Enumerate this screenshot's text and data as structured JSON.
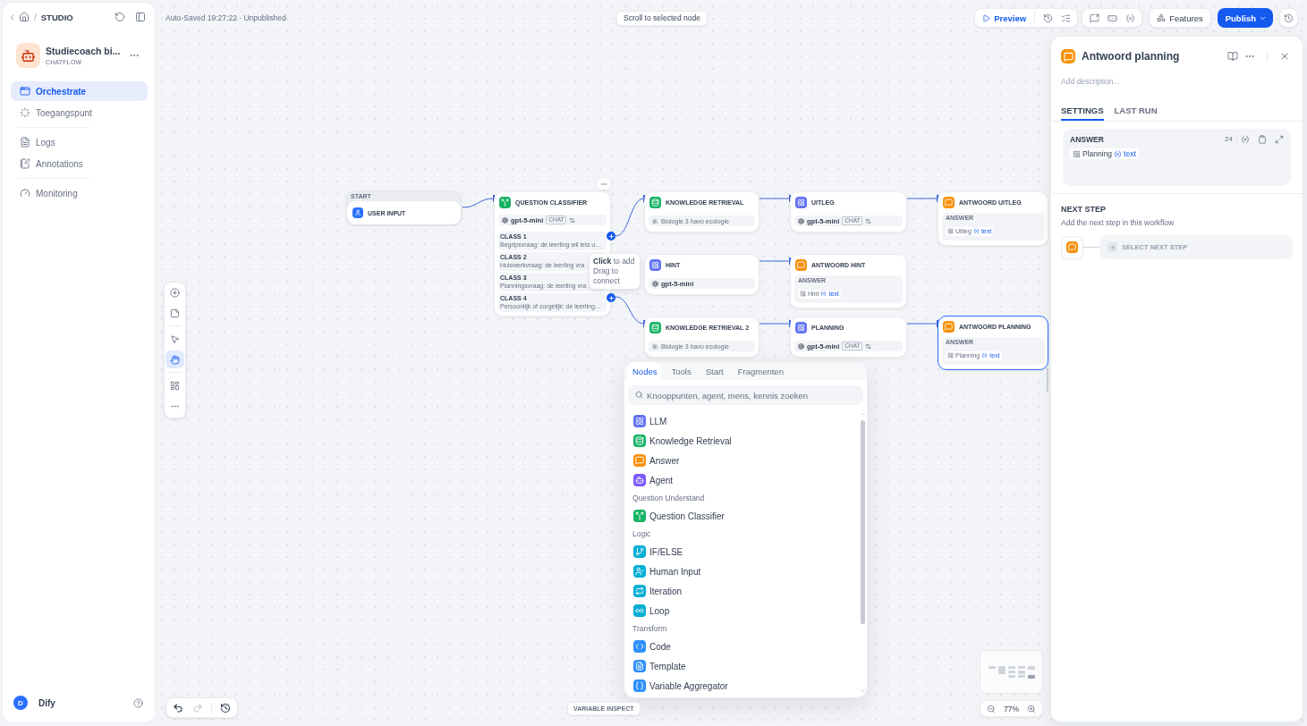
{
  "sidebar": {
    "breadcrumb": {
      "separator": "/",
      "current": "STUDIO"
    },
    "app": {
      "name": "Studiecoach bi...",
      "type": "CHATFLOW"
    },
    "nav_groups": [
      {
        "items": [
          {
            "label": "Orchestrate",
            "selected": true
          },
          {
            "label": "Toegangspunt",
            "selected": false
          }
        ]
      },
      {
        "items": [
          {
            "label": "Logs",
            "selected": false
          },
          {
            "label": "Annotations",
            "selected": false
          }
        ]
      },
      {
        "items": [
          {
            "label": "Monitoring",
            "selected": false
          }
        ]
      }
    ],
    "user": {
      "initial": "D",
      "name": "Dify"
    }
  },
  "toolbar": {
    "save_status": "Auto-Saved 19:27:22 · Unpublished",
    "scroll_hint": "Scroll to selected node",
    "preview": "Preview",
    "features": "Features",
    "publish": "Publish"
  },
  "canvas": {
    "tool_groups": [
      {
        "tools": [
          {
            "kind": "add",
            "selected": false
          },
          {
            "kind": "note",
            "selected": false
          }
        ]
      },
      {
        "tools": [
          {
            "kind": "pointer",
            "selected": false
          },
          {
            "kind": "hand",
            "selected": true
          }
        ]
      },
      {
        "tools": [
          {
            "kind": "layout",
            "selected": false
          },
          {
            "kind": "more",
            "selected": false
          }
        ]
      }
    ],
    "nodes": [
      {
        "kind": "start",
        "header": "START",
        "title": "USER INPUT",
        "selected": false
      },
      {
        "kind": "classifier",
        "title": "QUESTION CLASSIFIER",
        "model": "gpt-5-mini",
        "mode": "CHAT",
        "selected": false,
        "classes": [
          {
            "label": "CLASS 1",
            "text": "Begripsvraag: de leerling wil iets u…",
            "add_handle": true
          },
          {
            "label": "CLASS 2",
            "text": "Huiswerkvraag: de leerling vra",
            "add_handle": false
          },
          {
            "label": "CLASS 3",
            "text": "Planningsvraag: de leerling vra",
            "add_handle": false
          },
          {
            "label": "CLASS 4",
            "text": "Persoonlijk of zorgelijk: de leerling…",
            "add_handle": true
          }
        ]
      },
      {
        "kind": "knowledge",
        "title": "KNOWLEDGE RETRIEVAL",
        "dataset": "Biologie 3 havo ecologie",
        "selected": false
      },
      {
        "kind": "llm",
        "title": "HINT",
        "model": "gpt-5-mini",
        "selected": false
      },
      {
        "kind": "knowledge",
        "title": "KNOWLEDGE RETRIEVAL 2",
        "dataset": "Biologie 3 havo ecologie",
        "selected": false
      },
      {
        "kind": "llm",
        "title": "UITLEG",
        "model": "gpt-5-mini",
        "mode": "CHAT",
        "selected": false
      },
      {
        "kind": "answer",
        "title": "ANTWOORD HINT",
        "label": "ANSWER",
        "variable": "Hint",
        "field": "text",
        "selected": false
      },
      {
        "kind": "llm",
        "title": "PLANNING",
        "model": "gpt-5-mini",
        "mode": "CHAT",
        "selected": false
      },
      {
        "kind": "answer",
        "title": "ANTWOORD UITLEG",
        "label": "ANSWER",
        "variable": "Uitleg",
        "field": "text",
        "selected": false
      },
      {
        "kind": "answer",
        "title": "ANTWOORD PLANNING",
        "label": "ANSWER",
        "variable": "Planning",
        "field": "text",
        "selected": true
      }
    ],
    "tooltip": {
      "lines": [
        "**Click** to add",
        "Drag to connect"
      ]
    },
    "palette": {
      "tabs": [
        {
          "label": "Nodes",
          "selected": true
        },
        {
          "label": "Tools",
          "selected": false
        },
        {
          "label": "Start",
          "selected": false
        },
        {
          "label": "Fragmenten",
          "selected": false
        }
      ],
      "search": {
        "placeholder": "Knooppunten, agent, mens, kennis zoeken"
      },
      "groups": [
        {
          "items": [
            {
              "kind": "llm",
              "label": "LLM"
            },
            {
              "kind": "knowledge",
              "label": "Knowledge Retrieval"
            },
            {
              "kind": "answer",
              "label": "Answer"
            },
            {
              "kind": "agent",
              "label": "Agent"
            }
          ]
        },
        {
          "title": "Question Understand",
          "items": [
            {
              "kind": "classifier",
              "label": "Question Classifier"
            }
          ]
        },
        {
          "title": "Logic",
          "items": [
            {
              "kind": "ifelse",
              "label": "IF/ELSE"
            },
            {
              "kind": "human",
              "label": "Human Input"
            },
            {
              "kind": "iteration",
              "label": "Iteration"
            },
            {
              "kind": "loop",
              "label": "Loop"
            }
          ]
        },
        {
          "title": "Transform",
          "items": [
            {
              "kind": "code",
              "label": "Code"
            },
            {
              "kind": "template",
              "label": "Template"
            },
            {
              "kind": "aggregator",
              "label": "Variable Aggregator"
            }
          ]
        }
      ]
    },
    "history_controls": [
      {
        "kind": "undo",
        "disabled": false
      },
      {
        "kind": "redo",
        "disabled": true
      },
      {
        "kind": "history",
        "disabled": false
      }
    ],
    "variable_inspect": "VARIABLE INSPECT",
    "zoom": "77%"
  },
  "panel": {
    "kind": "answer",
    "title": "Antwoord planning",
    "description": {
      "placeholder": "Add description..."
    },
    "tabs": [
      {
        "label": "SETTINGS",
        "selected": true
      },
      {
        "label": "LAST RUN",
        "selected": false
      }
    ],
    "answer": {
      "label": "ANSWER",
      "count": "24",
      "variable": "Planning",
      "field": "text"
    },
    "next_step": {
      "title": "NEXT STEP",
      "subtitle": "Add the next step in this workflow",
      "action": "SELECT NEXT STEP"
    }
  }
}
